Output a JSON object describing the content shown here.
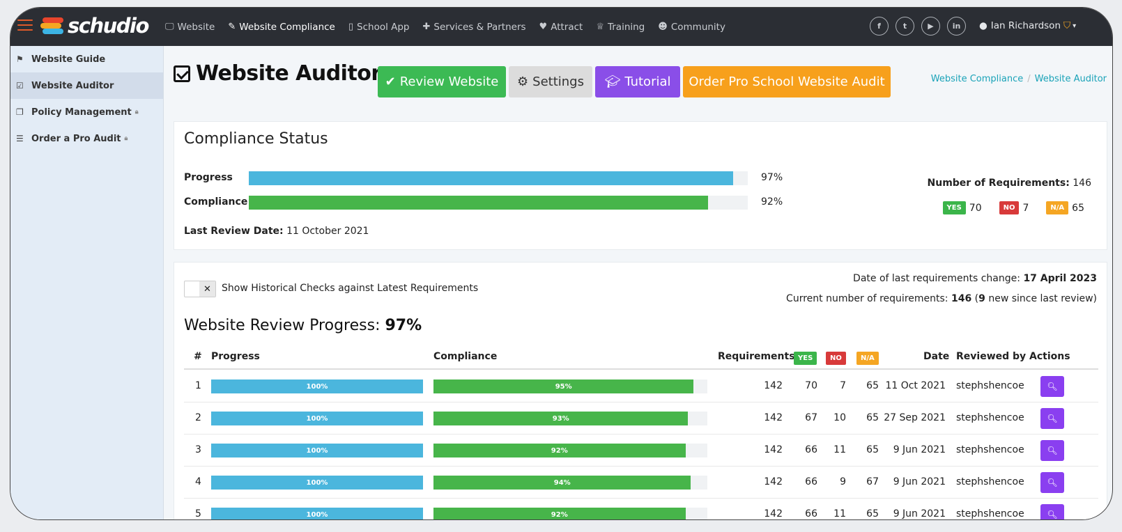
{
  "brand": {
    "name": "schudio"
  },
  "nav": [
    {
      "icon": "monitor-icon",
      "glyph": "🖵",
      "label": "Website"
    },
    {
      "icon": "wrench-icon",
      "glyph": "✎",
      "label": "Website Compliance"
    },
    {
      "icon": "mobile-icon",
      "glyph": "▯",
      "label": "School App"
    },
    {
      "icon": "puzzle-icon",
      "glyph": "✚",
      "label": "Services & Partners"
    },
    {
      "icon": "heart-icon",
      "glyph": "♥",
      "label": "Attract"
    },
    {
      "icon": "trophy-icon",
      "glyph": "♕",
      "label": "Training"
    },
    {
      "icon": "users-icon",
      "glyph": "☻",
      "label": "Community"
    }
  ],
  "socials": [
    {
      "icon": "facebook-icon",
      "glyph": "f"
    },
    {
      "icon": "twitter-icon",
      "glyph": "t"
    },
    {
      "icon": "youtube-icon",
      "glyph": "▶"
    },
    {
      "icon": "linkedin-icon",
      "glyph": "in"
    }
  ],
  "user": {
    "name": "Ian Richardson"
  },
  "sidebar": [
    {
      "icon": "signpost-icon",
      "glyph": "⚑",
      "label": "Website Guide",
      "locked": false
    },
    {
      "icon": "checkbox-icon",
      "glyph": "☑",
      "label": "Website Auditor",
      "locked": false
    },
    {
      "icon": "copy-icon",
      "glyph": "❐",
      "label": "Policy Management",
      "locked": true
    },
    {
      "icon": "sliders-icon",
      "glyph": "☰",
      "label": "Order a Pro Audit",
      "locked": true
    }
  ],
  "page": {
    "title": "Website Auditor",
    "buttons": {
      "review": "Review Website",
      "settings": "Settings",
      "tutorial": "Tutorial",
      "order": "Order Pro School Website Audit"
    },
    "breadcrumb": [
      "Website Compliance",
      "Website Auditor"
    ]
  },
  "status": {
    "title": "Compliance Status",
    "progress_label": "Progress",
    "progress_value": 97,
    "progress_text": "97%",
    "compliance_label": "Compliance",
    "compliance_value": 92,
    "compliance_text": "92%",
    "last_review_label": "Last Review Date:",
    "last_review_date": "11 October 2021",
    "requirements_label": "Number of Requirements:",
    "requirements_total": "146",
    "yes_label": "YES",
    "yes_count": "70",
    "no_label": "NO",
    "no_count": "7",
    "na_label": "N/A",
    "na_count": "65"
  },
  "review": {
    "toggle_label": "Show Historical Checks against Latest Requirements",
    "change_label": "Date of last requirements change:",
    "change_date": "17 April 2023",
    "current_label": "Current number of requirements:",
    "current_count": "146",
    "new_count": "9",
    "new_suffix": "new since last review)",
    "progress_title": "Website Review Progress:",
    "progress_value": "97%",
    "columns": {
      "num": "#",
      "progress": "Progress",
      "compliance": "Compliance",
      "requirements": "Requirements",
      "yes": "YES",
      "no": "NO",
      "na": "N/A",
      "date": "Date",
      "reviewed_by": "Reviewed by",
      "actions": "Actions"
    },
    "rows": [
      {
        "num": "1",
        "progress": 100,
        "progress_text": "100%",
        "compliance": 95,
        "compliance_text": "95%",
        "requirements": "142",
        "yes": "70",
        "no": "7",
        "na": "65",
        "date": "11 Oct 2021",
        "reviewer": "stephshencoe"
      },
      {
        "num": "2",
        "progress": 100,
        "progress_text": "100%",
        "compliance": 93,
        "compliance_text": "93%",
        "requirements": "142",
        "yes": "67",
        "no": "10",
        "na": "65",
        "date": "27 Sep 2021",
        "reviewer": "stephshencoe"
      },
      {
        "num": "3",
        "progress": 100,
        "progress_text": "100%",
        "compliance": 92,
        "compliance_text": "92%",
        "requirements": "142",
        "yes": "66",
        "no": "11",
        "na": "65",
        "date": "9 Jun 2021",
        "reviewer": "stephshencoe"
      },
      {
        "num": "4",
        "progress": 100,
        "progress_text": "100%",
        "compliance": 94,
        "compliance_text": "94%",
        "requirements": "142",
        "yes": "66",
        "no": "9",
        "na": "67",
        "date": "9 Jun 2021",
        "reviewer": "stephshencoe"
      },
      {
        "num": "5",
        "progress": 100,
        "progress_text": "100%",
        "compliance": 92,
        "compliance_text": "92%",
        "requirements": "142",
        "yes": "66",
        "no": "11",
        "na": "65",
        "date": "9 Jun 2021",
        "reviewer": "stephshencoe"
      }
    ]
  },
  "colors": {
    "topnav": "#2b2e34",
    "progress": "#4bb6dd",
    "compliance": "#47b54a",
    "yes": "#3bb54a",
    "no": "#d83a3a",
    "na": "#f5a623",
    "review_btn": "#3cba54",
    "settings_btn": "#dcdcdc",
    "tutorial_btn": "#8a4ee8",
    "order_btn": "#f7a01c",
    "view_btn": "#8a3ff0"
  }
}
